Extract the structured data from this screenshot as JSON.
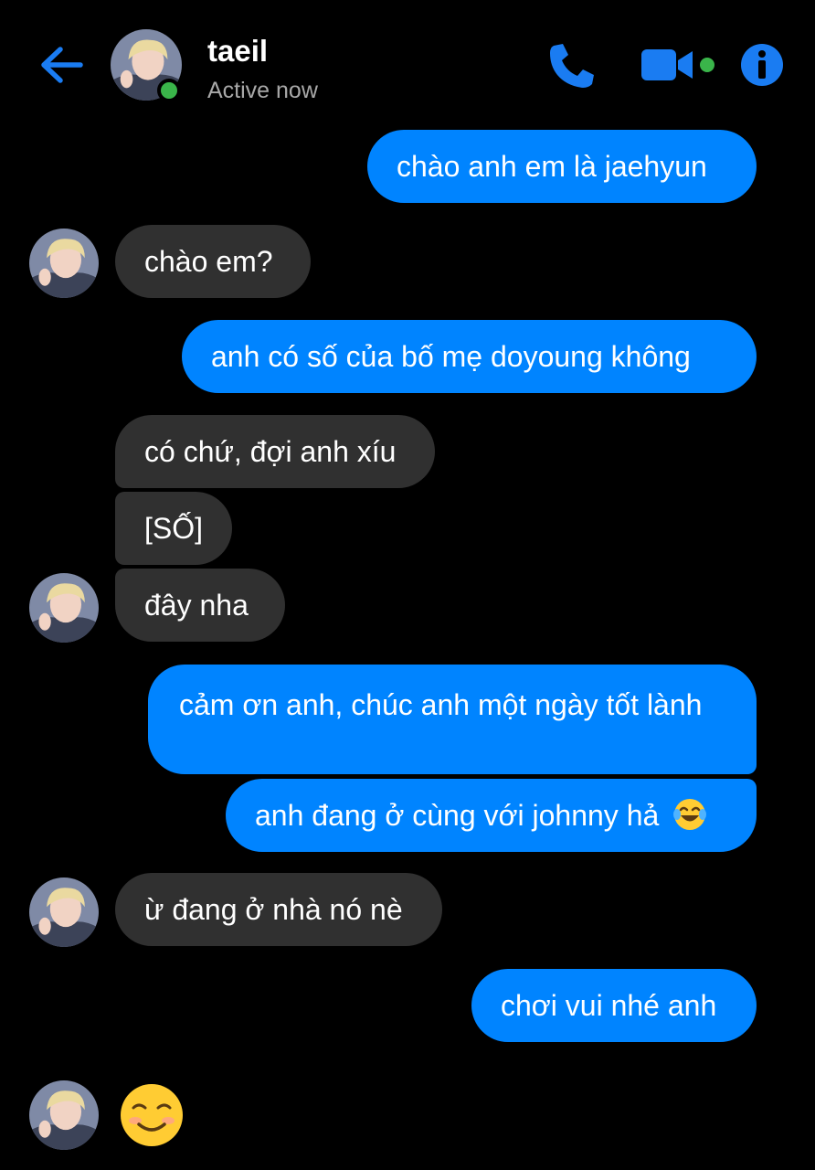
{
  "header": {
    "name": "taeil",
    "status": "Active now",
    "icons": [
      "back-arrow-icon",
      "phone-icon",
      "video-camera-icon",
      "info-icon"
    ]
  },
  "colors": {
    "accent": "#0084ff",
    "incoming_bubble": "#303030",
    "online": "#3ab54a"
  },
  "messages": [
    {
      "sender": "me",
      "text": "chào anh em là jaehyun"
    },
    {
      "sender": "taeil",
      "text": "chào em?"
    },
    {
      "sender": "me",
      "text": "anh có số của bố mẹ doyoung không"
    },
    {
      "sender": "taeil",
      "text": "có chứ, đợi anh xíu"
    },
    {
      "sender": "taeil",
      "text": "[SỐ]"
    },
    {
      "sender": "taeil",
      "text": "đây nha"
    },
    {
      "sender": "me",
      "text": "cảm ơn anh, chúc anh một ngày tốt lành"
    },
    {
      "sender": "me",
      "text": "anh đang ở cùng với johnny hả",
      "emoji": "face-with-tears-of-joy"
    },
    {
      "sender": "taeil",
      "text": "ừ đang ở nhà nó nè"
    },
    {
      "sender": "me",
      "text": "chơi vui nhé anh"
    },
    {
      "sender": "taeil",
      "emoji": "smiling-face"
    }
  ]
}
